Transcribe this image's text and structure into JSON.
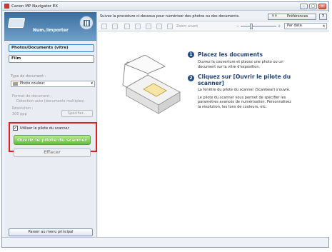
{
  "window": {
    "title": "Canon MP Navigator EX"
  },
  "left_panel": {
    "mode_label": "Num./Importer",
    "tabs": [
      {
        "label": "Photos/Documents (vitre)",
        "selected": true
      },
      {
        "label": "Film",
        "selected": false
      }
    ],
    "document_type_label": "Type de document :",
    "document_type_value": "Photo couleur",
    "document_format_label": "Format de document :",
    "document_format_value": "Détection auto (documents multiples)",
    "resolution_label": "Résolution :",
    "resolution_value": "300 ppp",
    "specify_button": "Spécifier...",
    "use_driver_checkbox": {
      "label": "Utiliser le pilote du scanner",
      "checked": true,
      "mark": "✓"
    },
    "open_driver_button": "Ouvrir le pilote du scanner",
    "erase_button": "Effacer",
    "main_menu_button": "Passer au menu principal"
  },
  "right_panel": {
    "instruction": "Suivez la procédure ci-dessous pour numériser des photos ou des documents.",
    "preferences_button": "Préférences",
    "preferences_icon": "↑↑",
    "help_button": "?",
    "zoom_label": "Zoom avant",
    "zoom_minus": "−",
    "zoom_plus": "+",
    "sort_select": "Par date",
    "steps": [
      {
        "num": "1",
        "title": "Placez les documents",
        "text": [
          "Ouvrez la couverture et placez une photo ou un",
          "document sur la vitre d'exposition."
        ]
      },
      {
        "num": "2",
        "title_lines": [
          "Cliquez sur [Ouvrir le pilote du",
          "scanner]"
        ],
        "text": [
          "La fenêtre du pilote du scanner (ScanGear) s'ouvre.",
          "",
          "Le pilote du scanner vous permet de spécifier les",
          "paramètres avancés de numérisation. Personnalisez",
          "la résolution, les tons de couleurs, etc."
        ]
      }
    ]
  },
  "colors": {
    "accent": "#3b6e9e",
    "highlight_red": "#e0201c",
    "green_button": "#5fbf3a"
  }
}
